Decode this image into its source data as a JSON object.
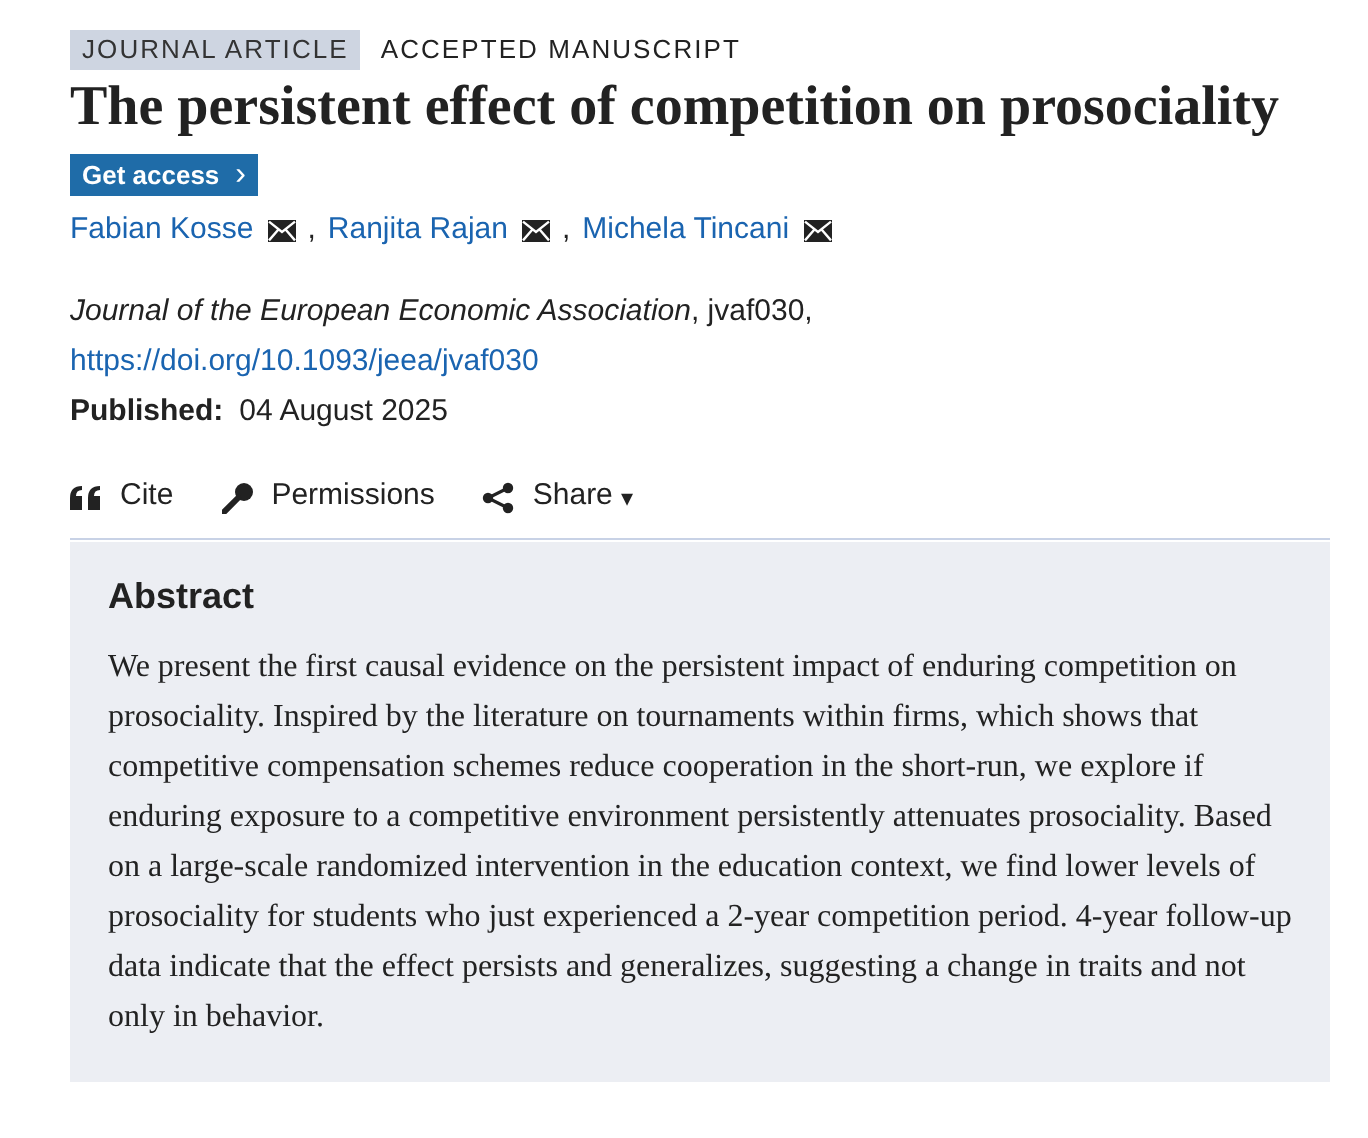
{
  "labels": [
    {
      "text": "JOURNAL ARTICLE",
      "kind": "tag"
    },
    {
      "text": "ACCEPTED MANUSCRIPT",
      "kind": "plain"
    }
  ],
  "title": "The persistent effect of competition on prosociality",
  "access_button": {
    "label": "Get access",
    "icon": "›"
  },
  "authors": [
    {
      "name": "Fabian Kosse",
      "separator": ","
    },
    {
      "name": "Ranjita Rajan",
      "separator": ","
    },
    {
      "name": "Michela Tincani"
    }
  ],
  "citation": "*Journal of the European Economic Association*, jvaf030,",
  "doi": "https://doi.org/10.1093/jeea/jvaf030",
  "published": {
    "label": "Published:",
    "date": "04 August 2025"
  },
  "actions": [
    {
      "kind": "cite",
      "label": "Cite"
    },
    {
      "kind": "permissions",
      "label": "Permissions"
    },
    {
      "kind": "share",
      "label": "Share",
      "caret": "▾"
    }
  ],
  "abstract": {
    "heading": "Abstract",
    "text": "We present the first causal evidence on the persistent impact of enduring competition on prosociality. Inspired by the literature on tournaments within firms, which shows that competitive compensation schemes reduce cooperation in the short-run, we explore if enduring exposure to a competitive environment persistently attenuates prosociality. Based on a large-scale randomized intervention in the education context, we find lower levels of prosociality for students who just experienced a 2-year competition period. 4-year follow-up data indicate that the effect persists and generalizes, suggesting a change in traits and not only in behavior."
  }
}
